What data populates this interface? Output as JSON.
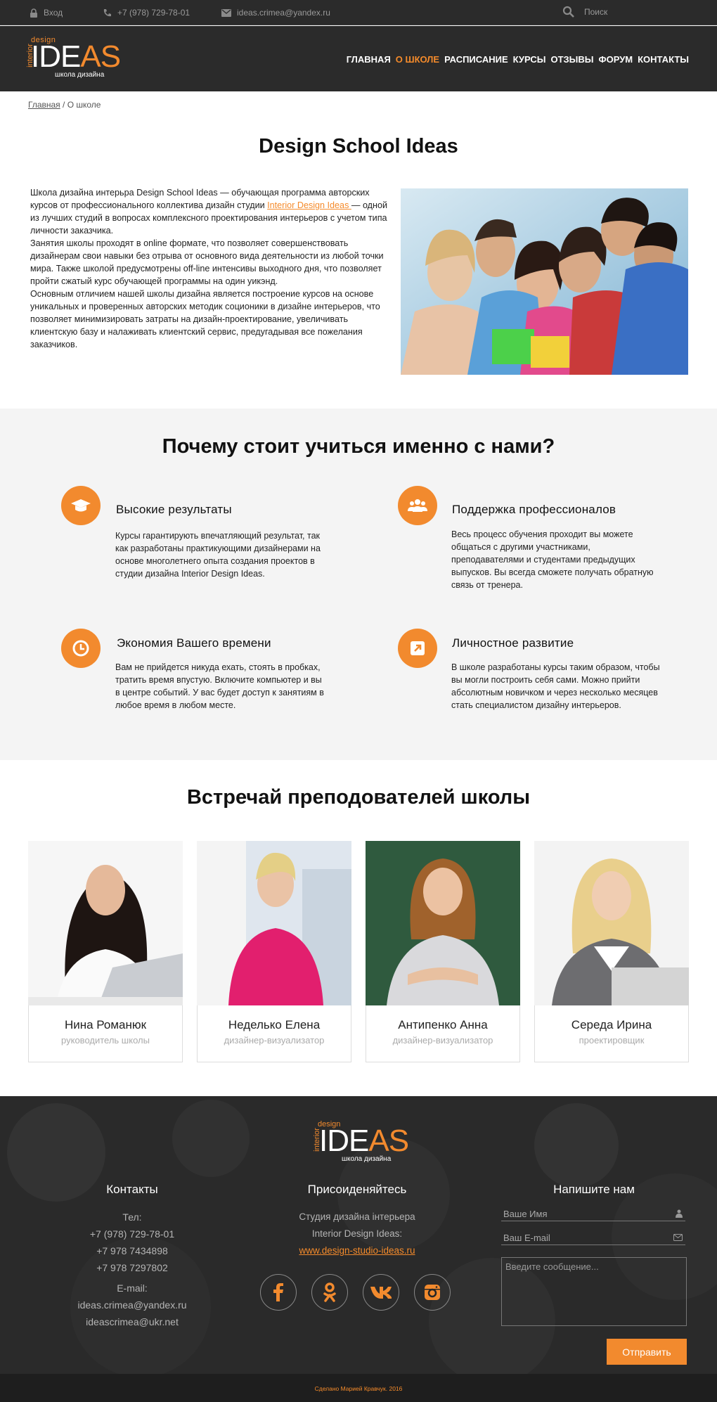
{
  "topbar": {
    "login": "Вход",
    "phone": "+7 (978) 729-78-01",
    "email": "ideas.crimea@yandex.ru",
    "search": "Поиск"
  },
  "logo": {
    "design": "design",
    "interior": "interior",
    "ideas": "IDEAS",
    "sub": "школа дизайна"
  },
  "nav": {
    "items": [
      "ГЛАВНАЯ",
      "О ШКОЛЕ",
      "РАСПИСАНИЕ",
      "КУРСЫ",
      "ОТЗЫВЫ",
      "ФОРУМ",
      "КОНТАКТЫ"
    ],
    "active": "О ШКОЛЕ"
  },
  "breadcrumb": {
    "home": "Главная",
    "sep": " / ",
    "current": "О школе"
  },
  "intro": {
    "title": "Design School Ideas",
    "p1_a": "Школа дизайна интерьра Design School Ideas — обучающая программа авторских курсов от профессионального коллектива дизайн студии ",
    "p1_link": "Interior Design Ideas ",
    "p1_b": "— одной из лучших студий в вопросах комплексного проектирования интерьеров с учетом типа личности заказчика.",
    "p2": "Занятия школы проходят в online формате, что позволяет совершенствовать дизайнерам свои навыки без отрыва от основного вида деятельности из любой точки мира. Также школой предусмотрены off-line интенсивы выходного дня, что позволяет пройти сжатый курс обучающей программы на один уикэнд.",
    "p3": "Основным отличием нашей школы дизайна является построение курсов на основе уникальных и проверенных авторских методик соционики в дизайне интерьеров, что позволяет минимизировать затраты на дизайн-проектирование, увеличивать клиентскую базу и налаживать клиентский сервис, предугадывая все пожелания заказчиков."
  },
  "why": {
    "title": "Почему стоит учиться именно с нами?",
    "features": [
      {
        "title": "Высокие результаты",
        "icon": "graduation-cap-icon",
        "text": "Курсы гарантирують впечатляющий результат, так как разработаны практикующими дизайнерами на основе многолетнего опыта создания проектов в студии дизайна Interior Design Ideas."
      },
      {
        "title": "Поддержка  профессионалов",
        "icon": "users-icon",
        "text": "Весь процесс обучения проходит вы можете общаться с другими участниками, преподавателями и студентами предыдущих выпусков. Вы всегда сможете получать обратную связь от тренера."
      },
      {
        "title": "Экономия Вашего времени",
        "icon": "clock-icon",
        "text": "Вам не прийдется никуда ехать, стоять в пробках, тратить время впустую. Включите компьютер и вы в центре событий. У вас будет доступ к занятиям в любое время в любом месте."
      },
      {
        "title": "Личностное развитие",
        "icon": "arrow-up-right-icon",
        "text": "В школе разработаны курсы таким образом, чтобы вы могли построить себя сами. Можно прийти абсолютным новичком и через несколько месяцев стать специалистом дизайну интерьеров."
      }
    ]
  },
  "teachers": {
    "title": "Встречай преподователей школы",
    "list": [
      {
        "name": "Нина Романюк",
        "role": "руководитель школы"
      },
      {
        "name": "Неделько Елена",
        "role": "дизайнер-визуализатор"
      },
      {
        "name": "Антипенко Анна",
        "role": "дизайнер-визуализатор"
      },
      {
        "name": "Середа Ирина",
        "role": "проектировщик"
      }
    ]
  },
  "footer": {
    "contacts": {
      "title": "Контакты",
      "tel_label": "Тел:",
      "phones": [
        "+7 (978) 729-78-01",
        "+7 978 7434898",
        "+7 978 7297802"
      ],
      "email_label": "E-mail:",
      "emails": [
        "ideas.crimea@yandex.ru",
        "ideascrimea@ukr.net"
      ]
    },
    "join": {
      "title": "Присоиденяйтесь",
      "line1": "Студия дизайна інтерьера",
      "line2": "Interior Design Ideas:",
      "site": "www.design-studio-ideas.ru",
      "social": [
        "facebook-icon",
        "odnoklassniki-icon",
        "vk-icon",
        "instagram-icon"
      ]
    },
    "form": {
      "title": "Напишите нам",
      "name_placeholder": "Ваше Имя",
      "email_placeholder": "Ваш E-mail",
      "message_placeholder": "Введите сообщение...",
      "submit": "Отправить"
    },
    "copyright": "Сделано Марией Кравчук. 2016"
  },
  "colors": {
    "accent": "#f28a2e",
    "dark": "#2b2b2b",
    "light_bg": "#f4f4f4"
  }
}
